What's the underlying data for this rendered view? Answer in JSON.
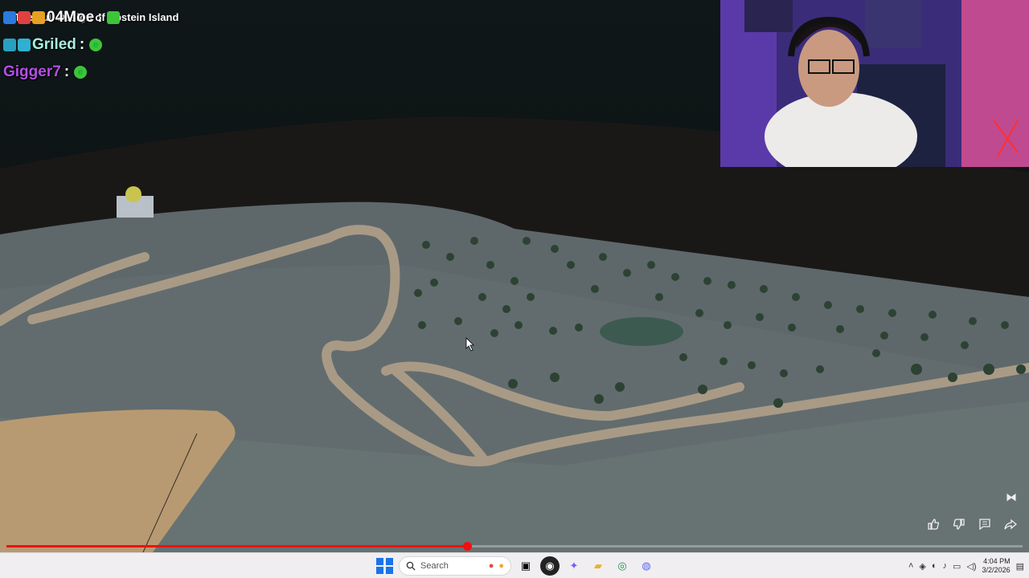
{
  "video": {
    "title_overlay": "The Full Design of Epstein Island",
    "progress_fraction": 0.453
  },
  "chat": [
    {
      "user": "04Moe",
      "color": "#ffffff",
      "emote": ""
    },
    {
      "user": "Griled",
      "color": "#a8f0e0",
      "emote": "e"
    },
    {
      "user": "Gigger7",
      "color": "#b44ee8",
      "emote": "e"
    }
  ],
  "actions": {
    "like_icon": "thumbs-up-icon",
    "dislike_icon": "thumbs-down-icon",
    "comment_icon": "comment-icon",
    "share_icon": "share-icon"
  },
  "taskbar": {
    "search_placeholder": "Search",
    "time": "4:04 PM",
    "date": "3/2/2026"
  }
}
